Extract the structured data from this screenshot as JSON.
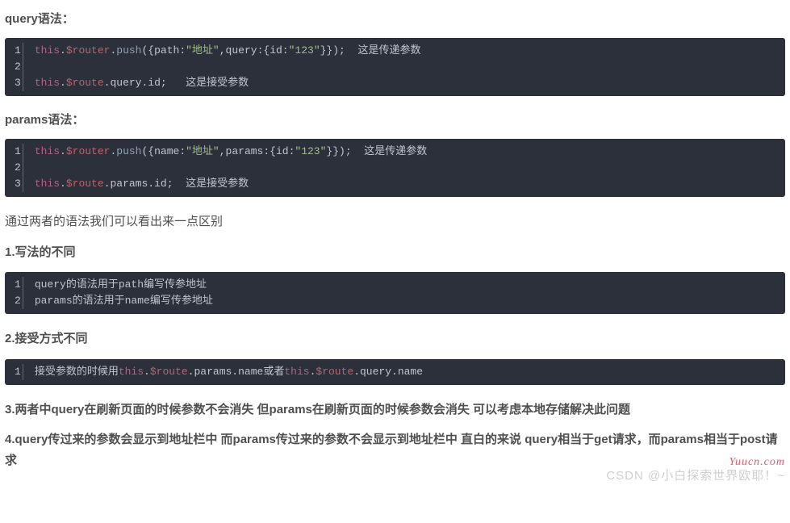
{
  "sections": {
    "s1": {
      "title": "query语法：",
      "code": {
        "lines": [
          "1",
          "2",
          "3"
        ],
        "line1": {
          "kw": "this",
          "dot1": ".",
          "prop": "$router",
          "dot2": ".",
          "method": "push",
          "paren1": "({",
          "k1": "path",
          "colon1": ":",
          "str1": "\"地址\"",
          "comma1": ",",
          "k2": "query",
          "colon2": ":",
          "brace1": "{",
          "k3": "id",
          "colon3": ":",
          "str2": "\"123\"",
          "brace2": "}});",
          "sp": "  ",
          "comment": "这是传递参数"
        },
        "line2": "",
        "line3": {
          "kw": "this",
          "dot1": ".",
          "prop": "$route",
          "dot2": ".",
          "k1": "query",
          "dot3": ".",
          "k2": "id",
          "semi": ";",
          "sp": "   ",
          "comment": "这是接受参数"
        }
      }
    },
    "s2": {
      "title": "params语法：",
      "code": {
        "lines": [
          "1",
          "2",
          "3"
        ],
        "line1": {
          "kw": "this",
          "dot1": ".",
          "prop": "$router",
          "dot2": ".",
          "method": "push",
          "paren1": "({",
          "k1": "name",
          "colon1": ":",
          "str1": "\"地址\"",
          "comma1": ",",
          "k2": "params",
          "colon2": ":",
          "brace1": "{",
          "k3": "id",
          "colon3": ":",
          "str2": "\"123\"",
          "brace2": "}});",
          "sp": "  ",
          "comment": "这是传递参数"
        },
        "line2": "",
        "line3": {
          "kw": "this",
          "dot1": ".",
          "prop": "$route",
          "dot2": ".",
          "k1": "params",
          "dot3": ".",
          "k2": "id",
          "semi": ";",
          "sp": "  ",
          "comment": "这是接受参数"
        }
      }
    },
    "p1": "通过两者的语法我们可以看出来一点区别",
    "h1": "1.写法的不同",
    "code3": {
      "lines": [
        "1",
        "2"
      ],
      "line1": "query的语法用于path编写传参地址",
      "line2": "params的语法用于name编写传参地址"
    },
    "h2": "2.接受方式不同",
    "code4": {
      "lines": [
        "1"
      ],
      "line1": {
        "t1": "接受参数的时候用",
        "kw1": "this",
        "d1": ".",
        "prop1": "$route",
        "d2": ".",
        "k1": "params",
        "d3": ".",
        "k2": "name",
        "mid": "或者",
        "kw2": "this",
        "d4": ".",
        "prop2": "$route",
        "d5": ".",
        "k3": "query",
        "d6": ".",
        "k4": "name"
      }
    },
    "h3": "3.两者中query在刷新页面的时候参数不会消失 但params在刷新页面的时候参数会消失 可以考虑本地存储解决此问题",
    "h4": "4.query传过来的参数会显示到地址栏中 而params传过来的参数不会显示到地址栏中 直白的来说 query相当于get请求，而params相当于post请求"
  },
  "watermarks": {
    "w1": "Yuucn.com",
    "w2": "CSDN @小白探索世界欧耶！~"
  }
}
